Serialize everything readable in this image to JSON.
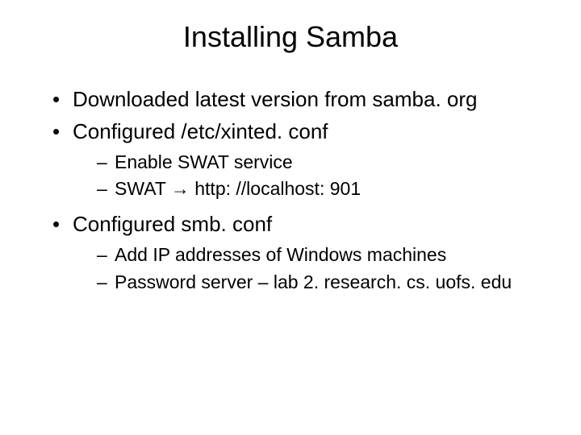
{
  "title": "Installing Samba",
  "bullets": {
    "b1": "Downloaded latest version from samba. org",
    "b2": "Configured /etc/xinted. conf",
    "b2_subs": {
      "s1": "Enable SWAT service",
      "s2_prefix": "SWAT  ",
      "s2_arrow": "→",
      "s2_suffix": " http: //localhost: 901"
    },
    "b3": "Configured smb. conf",
    "b3_subs": {
      "s1": "Add IP addresses of Windows machines",
      "s2": "Password server – lab 2. research. cs. uofs. edu"
    }
  }
}
